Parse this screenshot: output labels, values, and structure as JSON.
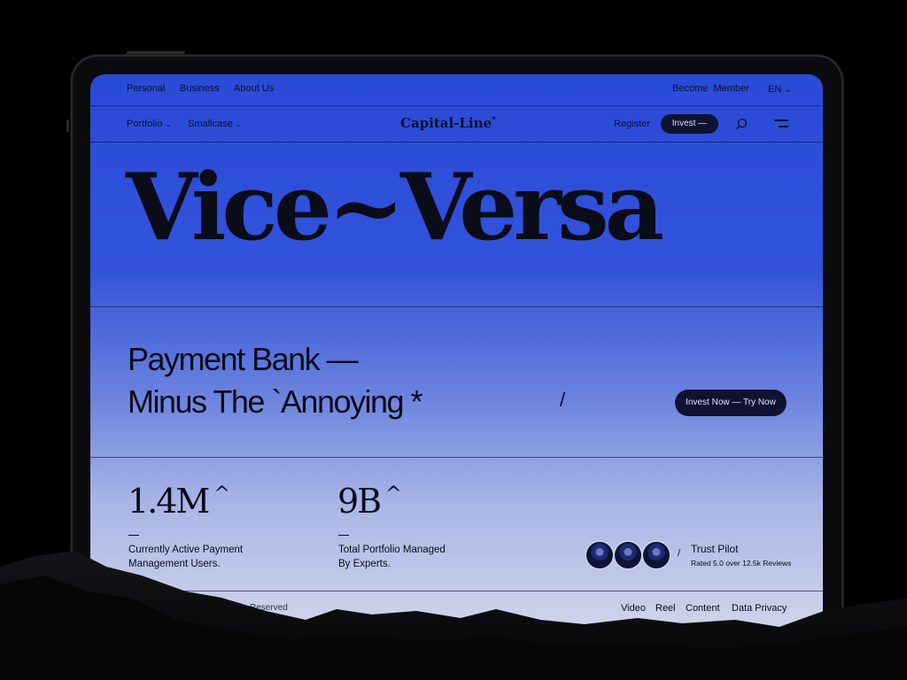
{
  "top_nav": {
    "personal": "Personal",
    "business": "Business",
    "about": "About Us",
    "become_member": "Become  Member",
    "language": "EN"
  },
  "main_nav": {
    "portfolio": "Portfolio",
    "smallcase": "Smallcase",
    "logo": "Capital-Line",
    "logo_mark": "*",
    "register": "Register",
    "invest": "Invest —"
  },
  "hero": {
    "title": "Vice~Versa"
  },
  "tagline": {
    "line1": "Payment Bank —",
    "line2": "Minus The `Annoying *",
    "slash": "/"
  },
  "cta": {
    "label": "Invest Now — Try Now"
  },
  "stats": [
    {
      "value": "1.4M",
      "caret": "^",
      "label_line1": "Currently Active Payment",
      "label_line2": "Management Users."
    },
    {
      "value": "9B",
      "caret": "^",
      "label_line1": "Total Portfolio Managed",
      "label_line2": "By Experts."
    }
  ],
  "trust": {
    "separator": "/",
    "title": "Trust Pilot",
    "rating": "Rated 5.0 over 12.5k Reviews"
  },
  "footer": {
    "left_text": "Reserved",
    "links": [
      "Video",
      "Reel",
      "Content",
      "Data Privacy"
    ]
  },
  "colors": {
    "accent": "#2a4ad8",
    "dark": "#0f1230"
  }
}
